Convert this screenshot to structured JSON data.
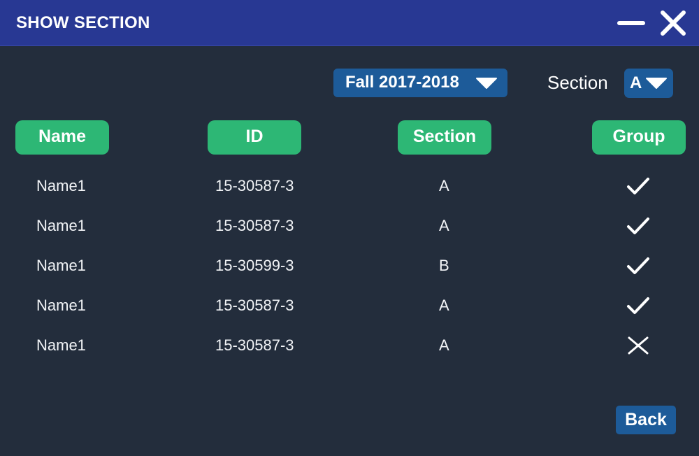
{
  "window": {
    "title": "SHOW SECTION"
  },
  "filters": {
    "semester": "Fall 2017-2018",
    "section_label": "Section",
    "section_value": "A"
  },
  "table": {
    "headers": {
      "name": "Name",
      "id": "ID",
      "section": "Section",
      "group": "Group"
    },
    "rows": [
      {
        "name": "Name1",
        "id": "15-30587-3",
        "section": "A",
        "group": "check-icon"
      },
      {
        "name": "Name1",
        "id": "15-30587-3",
        "section": "A",
        "group": "check-icon"
      },
      {
        "name": "Name1",
        "id": "15-30599-3",
        "section": "B",
        "group": "check-icon"
      },
      {
        "name": "Name1",
        "id": "15-30587-3",
        "section": "A",
        "group": "check-icon"
      },
      {
        "name": "Name1",
        "id": "15-30587-3",
        "section": "A",
        "group": "cross-icon"
      }
    ]
  },
  "footer": {
    "back_label": "Back"
  },
  "colors": {
    "background": "#232d3c",
    "titlebar": "#283893",
    "header_green": "#2db775",
    "button_blue": "#1d5b99",
    "text": "#ffffff"
  }
}
